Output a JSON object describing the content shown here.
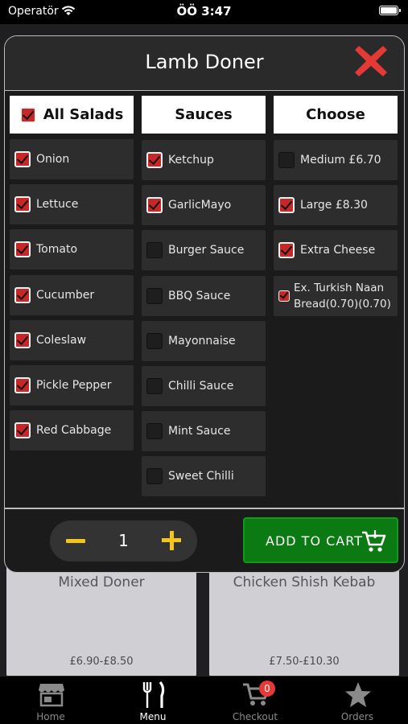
{
  "status": {
    "carrier": "Operatör",
    "time": "ÖÖ 3:47"
  },
  "background": {
    "cards": [
      {
        "name": "Mixed Doner",
        "price": "£6.90-£8.50"
      },
      {
        "name": "Chicken Shish Kebab",
        "price": "£7.50-£10.30"
      }
    ]
  },
  "modal": {
    "title": "Lamb Doner",
    "columns": {
      "salads": {
        "header": "All Salads",
        "header_checked": true,
        "items": [
          {
            "label": "Onion",
            "checked": true
          },
          {
            "label": "Lettuce",
            "checked": true
          },
          {
            "label": "Tomato",
            "checked": true
          },
          {
            "label": "Cucumber",
            "checked": true
          },
          {
            "label": "Coleslaw",
            "checked": true
          },
          {
            "label": "Pickle Pepper",
            "checked": true
          },
          {
            "label": "Red Cabbage",
            "checked": true
          }
        ]
      },
      "sauces": {
        "header": "Sauces",
        "items": [
          {
            "label": "Ketchup",
            "checked": true
          },
          {
            "label": "GarlicMayo",
            "checked": true
          },
          {
            "label": "Burger Sauce",
            "checked": false
          },
          {
            "label": "BBQ Sauce",
            "checked": false
          },
          {
            "label": "Mayonnaise",
            "checked": false
          },
          {
            "label": "Chilli Sauce",
            "checked": false
          },
          {
            "label": "Mint Sauce",
            "checked": false
          },
          {
            "label": "Sweet Chilli",
            "checked": false
          }
        ]
      },
      "choose": {
        "header": "Choose",
        "items": [
          {
            "label": "Medium £6.70",
            "checked": false
          },
          {
            "label": "Large £8.30",
            "checked": true
          },
          {
            "label": "Extra Cheese",
            "checked": true
          },
          {
            "label": "Ex. Turkish Naan Bread(0.70)(0.70)",
            "checked": true
          }
        ]
      }
    },
    "quantity": "1",
    "add_to_cart_label": "ADD TO CART"
  },
  "tabbar": {
    "tabs": [
      {
        "label": "Home",
        "icon": "store-icon"
      },
      {
        "label": "Menu",
        "icon": "fork-knife-icon",
        "active": true
      },
      {
        "label": "Checkout",
        "icon": "cart-icon",
        "badge": "0"
      },
      {
        "label": "Orders",
        "icon": "star-icon"
      }
    ]
  },
  "colors": {
    "accent_check": "#c62828",
    "cart_button": "#0c7a12",
    "stepper": "#f5c518",
    "close": "#e53935"
  }
}
